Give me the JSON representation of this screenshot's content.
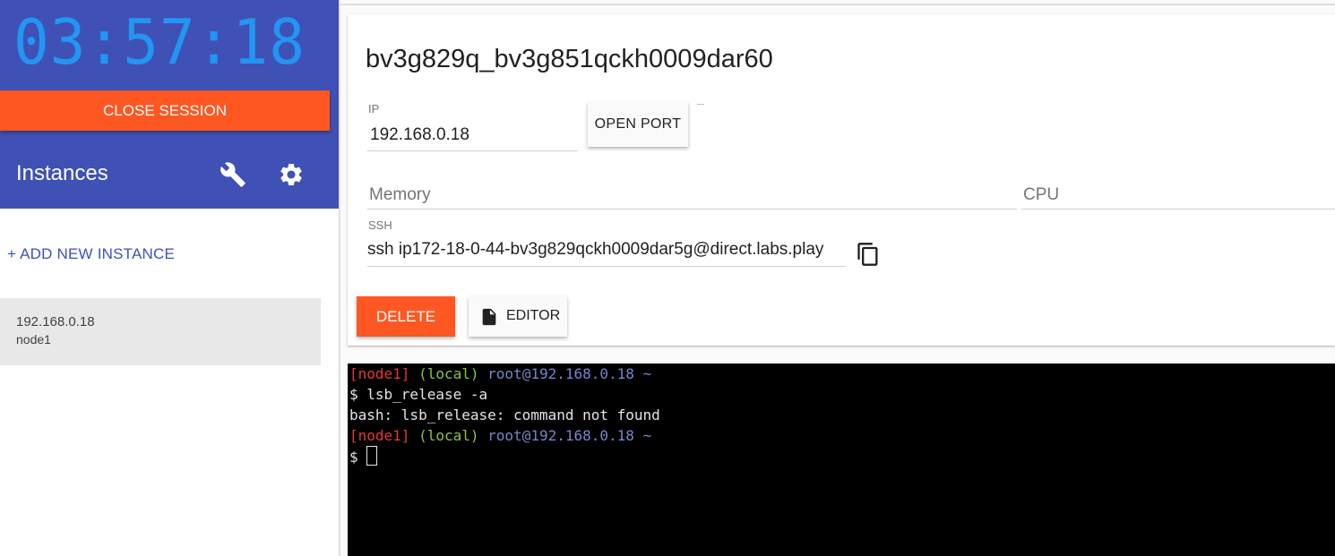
{
  "colors": {
    "sidebar_bg": "#3f51b5",
    "timer": "#2196f3",
    "accent_orange": "#ff5722",
    "link_blue": "#3f51b5",
    "term_red": "#e53935",
    "term_green": "#8bc34a",
    "term_blue": "#7986cb"
  },
  "sidebar": {
    "timer": "03:57:18",
    "close_session_label": "CLOSE SESSION",
    "instances_title": "Instances",
    "wrench_icon": "wrench-icon",
    "settings_icon": "gear-icon",
    "add_instance_label": "+ ADD NEW INSTANCE",
    "instances": [
      {
        "ip": "192.168.0.18",
        "name": "node1"
      }
    ]
  },
  "card": {
    "title": "bv3g829q_bv3g851qckh0009dar60",
    "ip_label": "IP",
    "ip_value": "192.168.0.18",
    "open_port_label": "OPEN PORT",
    "memory_placeholder": "Memory",
    "cpu_placeholder": "CPU",
    "ssh_label": "SSH",
    "ssh_value": "ssh ip172-18-0-44-bv3g829qckh0009dar5g@direct.labs.play",
    "copy_icon": "copy-icon",
    "delete_label": "DELETE",
    "editor_label": "EDITOR",
    "editor_icon": "file-icon"
  },
  "terminal": {
    "lines": [
      {
        "node": "[node1]",
        "local": "(local)",
        "userhost": "root@192.168.0.18",
        "tilde": "~"
      },
      {
        "text": "$ lsb_release -a"
      },
      {
        "text": "bash: lsb_release: command not found"
      },
      {
        "node": "[node1]",
        "local": "(local)",
        "userhost": "root@192.168.0.18",
        "tilde": "~"
      },
      {
        "text": "$ "
      }
    ]
  }
}
